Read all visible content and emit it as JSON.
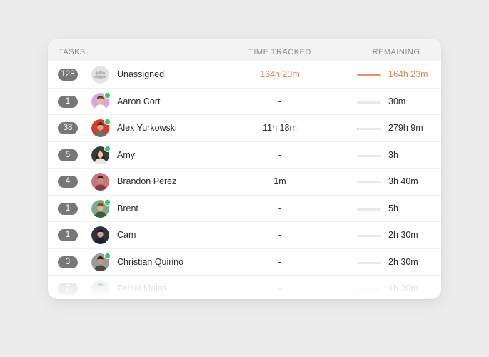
{
  "header": {
    "tasks": "TASKS",
    "time_tracked": "TIME TRACKED",
    "remaining": "REMAINING"
  },
  "colors": {
    "accent": "#e28a5e",
    "badge": "#777777",
    "online": "#3cc26b"
  },
  "rows": [
    {
      "tasks": "128",
      "name": "Unassigned",
      "tracked": "164h 23m",
      "remaining": "164h 23m",
      "progress": 1.0,
      "avatar": "group-icon",
      "online": false
    },
    {
      "tasks": "1",
      "name": "Aaron Cort",
      "tracked": "-",
      "remaining": "30m",
      "progress": 0.0,
      "avatar": "aaron-avatar",
      "online": true
    },
    {
      "tasks": "38",
      "name": "Alex Yurkowski",
      "tracked": "11h 18m",
      "remaining": "279h 9m",
      "progress": 0.04,
      "avatar": "alex-avatar",
      "online": true
    },
    {
      "tasks": "5",
      "name": "Amy",
      "tracked": "-",
      "remaining": "3h",
      "progress": 0.0,
      "avatar": "amy-avatar",
      "online": true
    },
    {
      "tasks": "4",
      "name": "Brandon Perez",
      "tracked": "1m",
      "remaining": "3h 40m",
      "progress": 0.0,
      "avatar": "brandon-avatar",
      "online": false
    },
    {
      "tasks": "1",
      "name": "Brent",
      "tracked": "-",
      "remaining": "5h",
      "progress": 0.0,
      "avatar": "brent-avatar",
      "online": true
    },
    {
      "tasks": "1",
      "name": "Cam",
      "tracked": "-",
      "remaining": "2h 30m",
      "progress": 0.0,
      "avatar": "cam-avatar",
      "online": false
    },
    {
      "tasks": "3",
      "name": "Christian Quirino",
      "tracked": "-",
      "remaining": "2h 30m",
      "progress": 0.0,
      "avatar": "christian-avatar",
      "online": true
    },
    {
      "tasks": "2",
      "name": "Faisal Malas",
      "tracked": "-",
      "remaining": "1h 30m",
      "progress": 0.0,
      "avatar": "faisal-avatar",
      "online": false
    }
  ]
}
